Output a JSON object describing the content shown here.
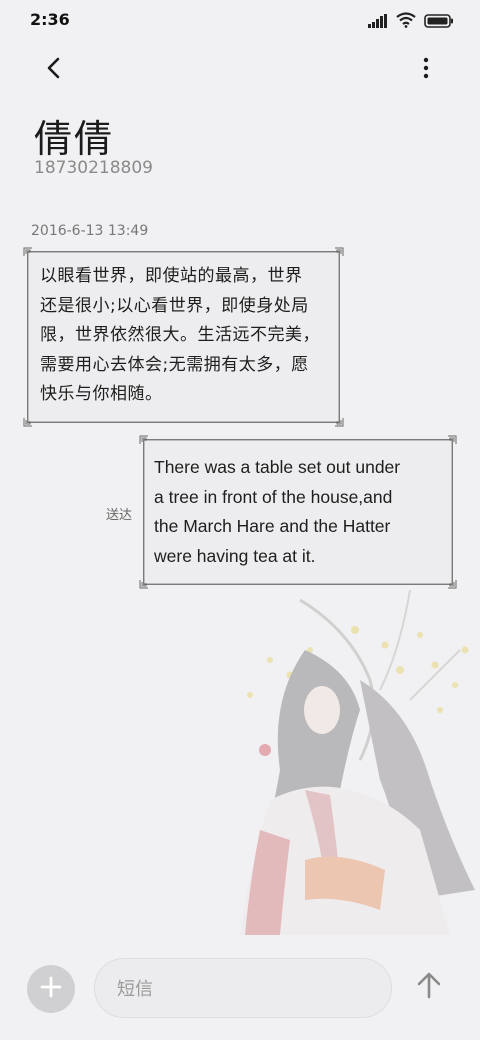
{
  "status_bar": {
    "time": "2:36",
    "icons": [
      "signal-icon",
      "wifi-icon",
      "battery-icon"
    ]
  },
  "header": {
    "back_icon": "chevron-left-icon",
    "more_icon": "more-vertical-icon"
  },
  "contact": {
    "name": "倩倩",
    "number": "18730218809"
  },
  "conversation": {
    "timestamp": "2016-6-13 13:49",
    "incoming": {
      "lines": [
        "以眼看世界，即使站的最高，世界",
        "还是很小;以心看世界，即使身处局",
        "限，世界依然很大。生活远不完美，",
        "需要用心去体会;无需拥有太多，愿",
        "快乐与你相随。"
      ]
    },
    "outgoing": {
      "lines": [
        "There was a table set out under",
        "a tree in front of the house,and",
        "the March Hare and the Hatter",
        "were having tea at it."
      ],
      "status": "送达"
    }
  },
  "composer": {
    "add_icon": "plus-icon",
    "placeholder": "短信",
    "send_icon": "arrow-up-icon"
  },
  "colors": {
    "background": "#f1f1f3",
    "bubble_border": "#7a7a7a",
    "secondary_text": "#8a8a8a"
  }
}
